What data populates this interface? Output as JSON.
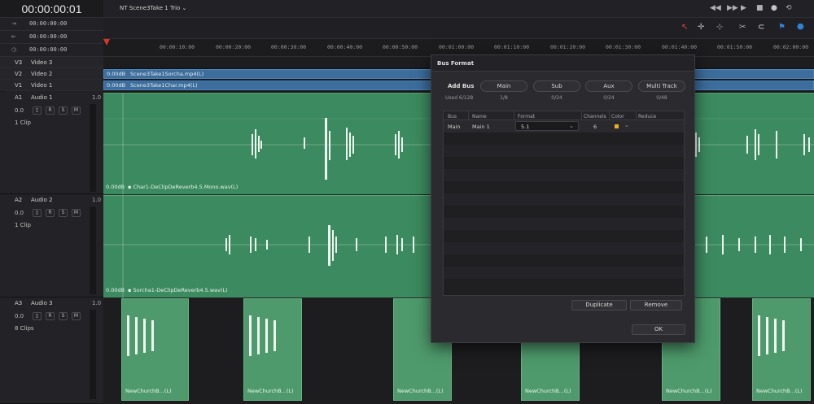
{
  "timecode": "00:00:00:01",
  "timecode_rows": [
    {
      "icon": "in-point-icon",
      "glyph": "⇥",
      "value": "00:00:00:00"
    },
    {
      "icon": "out-point-icon",
      "glyph": "⇤",
      "value": "00:00:00:00"
    },
    {
      "icon": "duration-icon",
      "glyph": "◷",
      "value": "00:00:00:00"
    }
  ],
  "timeline_title": "NT Scene3Take 1 Trio",
  "ruler_ticks": [
    "00:00:10:00",
    "00:00:20:00",
    "00:00:30:00",
    "00:00:40:00",
    "00:00:50:00",
    "00:01:00:00",
    "00:01:10:00",
    "00:01:20:00",
    "00:01:30:00",
    "00:01:40:00",
    "00:01:50:00",
    "00:02:00:00"
  ],
  "video_tracks": [
    {
      "id": "V3",
      "name": "Video 3"
    },
    {
      "id": "V2",
      "name": "Video 2",
      "clip_db": "0.00dB",
      "clip": "Scene3Take1Sorcha.mp4(L)"
    },
    {
      "id": "V1",
      "name": "Video 1",
      "clip_db": "0.00dB",
      "clip": "Scene3Take1Char.mp4(L)"
    }
  ],
  "audio_tracks": [
    {
      "id": "A1",
      "name": "Audio 1",
      "type": "1.0",
      "volume": "0.0",
      "clips_label": "1 Clip",
      "clip_db": "0.00dB",
      "clip_name": "▪ Char1-DeClipDeReverb4.5.Mono.wav(L)"
    },
    {
      "id": "A2",
      "name": "Audio 2",
      "type": "1.0",
      "volume": "0.0",
      "clips_label": "1 Clip",
      "clip_db": "0.00dB",
      "clip_name": "▪ Sorcha1-DeClipDeReverb4.5.wav(L)"
    },
    {
      "id": "A3",
      "name": "Audio 3",
      "type": "1.0",
      "volume": "0.0",
      "clips_label": "8 Clips"
    }
  ],
  "track_buttons": {
    "r": "R",
    "s": "S",
    "m": "M"
  },
  "small_clip_name": "NewChurchB...(L)",
  "dialog": {
    "title": "Bus Format",
    "add_bus": "Add Bus",
    "used": "Used 6/128",
    "bus_types": [
      {
        "label": "Main",
        "count": "1/8"
      },
      {
        "label": "Sub",
        "count": "0/24"
      },
      {
        "label": "Aux",
        "count": "0/24"
      },
      {
        "label": "Multi Track",
        "count": "0/48"
      }
    ],
    "columns": [
      "Bus",
      "Name",
      "Format",
      "Channels",
      "Color",
      "Reduce"
    ],
    "rows": [
      {
        "bus": "Main",
        "name": "Main 1",
        "format": "5.1",
        "channels": "6",
        "color": "#e6b225"
      }
    ],
    "duplicate": "Duplicate",
    "remove": "Remove",
    "ok": "OK"
  }
}
